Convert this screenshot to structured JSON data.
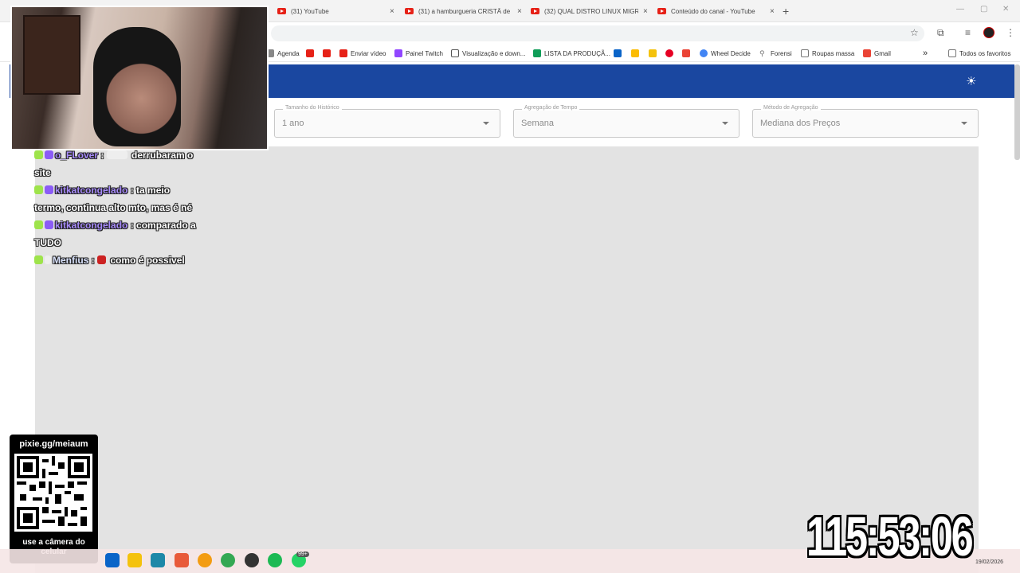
{
  "browser": {
    "tabs": [
      {
        "title": "(31) YouTube"
      },
      {
        "title": "(31) a hamburgueria CRISTÃ de"
      },
      {
        "title": "(32) QUAL DISTRO LINUX MIGR"
      },
      {
        "title": "Conteúdo do canal - YouTube"
      }
    ],
    "new_tab_symbol": "+",
    "close_symbol": "×",
    "bookmarks": [
      {
        "label": "Agenda",
        "icon": "calendar-icon",
        "color": "#888888"
      },
      {
        "label": "",
        "icon": "youtube-icon",
        "color": "#e62117"
      },
      {
        "label": "",
        "icon": "youtube-icon",
        "color": "#e62117"
      },
      {
        "label": "Enviar vídeo",
        "icon": "youtube-icon",
        "color": "#e62117"
      },
      {
        "label": "Painel Twitch",
        "icon": "twitch-icon",
        "color": "#9146ff"
      },
      {
        "label": "Visualização e down...",
        "icon": "doc-icon",
        "color": "#555555"
      },
      {
        "label": "LISTA DA PRODUÇÃ...",
        "icon": "sheets-icon",
        "color": "#0f9d58"
      },
      {
        "label": "Wheel Decide",
        "icon": "wheel-icon",
        "color": "#4285f4"
      },
      {
        "label": "Forensi",
        "icon": "search-icon",
        "color": "#777777"
      },
      {
        "label": "Roupas massa",
        "icon": "folder-icon",
        "color": "#777777"
      },
      {
        "label": "Gmail",
        "icon": "gmail-icon",
        "color": "#ea4335"
      },
      {
        "label": "Todos os favoritos",
        "icon": "folder-icon",
        "color": "#777777"
      }
    ]
  },
  "filters": [
    {
      "label": "Tamanho do Histórico",
      "value": "1 ano"
    },
    {
      "label": "Agregação de Tempo",
      "value": "Semana"
    },
    {
      "label": "Método de Agregação",
      "value": "Mediana dos Preços"
    }
  ],
  "chat": [
    {
      "user": "o_FLover",
      "text": "derrubaram o",
      "badges": [
        "b-green",
        "b-purple"
      ]
    },
    {
      "user": "",
      "text": "site",
      "badges": []
    },
    {
      "user": "kitkatcongelado",
      "text": "ta meio",
      "badges": [
        "b-green",
        "b-purple"
      ]
    },
    {
      "user": "",
      "text": "termo, continua alto mto, mas é né",
      "badges": []
    },
    {
      "user": "kitkatcongelado",
      "text": "comparado a",
      "badges": [
        "b-green",
        "b-purple"
      ]
    },
    {
      "user": "",
      "text": "TUDO",
      "badges": []
    },
    {
      "user": "Menfius",
      "text": "como é possivel",
      "badges": [
        "b-green",
        "b-white"
      ]
    }
  ],
  "qr": {
    "url": "pixie.gg/meiaum",
    "caption": "use a câmera do celular"
  },
  "timer": "115:53:06",
  "taskbar": {
    "date": "19/02/2026",
    "notification_badge": "99+"
  },
  "colors": {
    "appbar": "#1a47a0",
    "chart_bg": "#e3e3e3"
  }
}
